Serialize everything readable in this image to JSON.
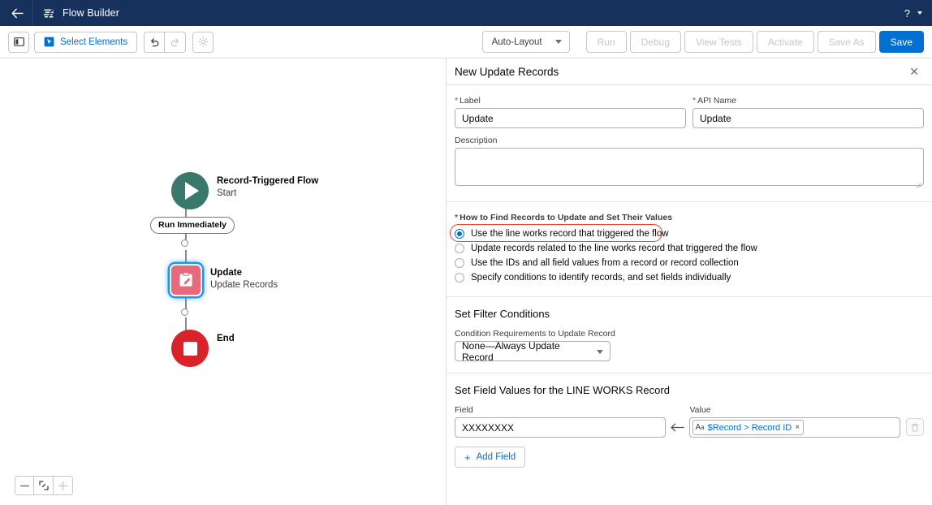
{
  "header": {
    "back_icon": "arrow-left-icon",
    "logo_icon": "flow-builder-logo-icon",
    "title": "Flow Builder",
    "help_icon": "question-mark-icon",
    "help_caret_icon": "chevron-down-icon"
  },
  "toolbar": {
    "panel_toggle_icon": "side-panel-icon",
    "select_elements_icon": "cursor-select-icon",
    "select_elements_label": "Select Elements",
    "undo_icon": "undo-icon",
    "redo_icon": "redo-icon",
    "settings_icon": "gear-icon",
    "layout_mode": "Auto-Layout",
    "layout_caret_icon": "chevron-down-icon",
    "actions": [
      {
        "label": "Run",
        "enabled": false
      },
      {
        "label": "Debug",
        "enabled": false
      },
      {
        "label": "View Tests",
        "enabled": false
      },
      {
        "label": "Activate",
        "enabled": false
      },
      {
        "label": "Save As",
        "enabled": false
      },
      {
        "label": "Save",
        "enabled": true,
        "primary": true
      }
    ],
    "primary_color": "#0070d2"
  },
  "canvas": {
    "start_node": {
      "icon": "play-icon",
      "title": "Record-Triggered Flow",
      "subtitle": "Start",
      "color": "#39796b"
    },
    "run_badge": "Run Immediately",
    "update_node": {
      "icon": "update-records-clipboard-icon",
      "title": "Update",
      "subtitle": "Update Records",
      "color": "#e8697d",
      "selected": true
    },
    "end_node": {
      "icon": "stop-square-icon",
      "title": "End",
      "color": "#d8232a"
    },
    "zoom_controls": [
      {
        "name": "zoom-out-button",
        "icon": "minus-icon",
        "enabled": true
      },
      {
        "name": "zoom-to-fit-button",
        "icon": "fit-to-view-icon",
        "enabled": true
      },
      {
        "name": "zoom-in-button",
        "icon": "plus-icon",
        "enabled": false
      }
    ]
  },
  "panel": {
    "title": "New Update Records",
    "close_icon": "close-icon",
    "label_field": {
      "label": "Label",
      "required": true,
      "value": "Update",
      "placeholder": ""
    },
    "api_name_field": {
      "label": "API Name",
      "required": true,
      "value": "Update",
      "placeholder": ""
    },
    "description_field": {
      "label": "Description",
      "value": "",
      "placeholder": ""
    },
    "how_to_find": {
      "label": "How to Find Records to Update and Set Their Values",
      "required": true,
      "selected_index": 0,
      "options": [
        "Use the line works record that triggered the flow",
        "Update records related to the line works record that triggered the flow",
        "Use the IDs and all field values from a record or record collection",
        "Specify conditions to identify records, and set fields individually"
      ],
      "annotation_color": "#e8452c"
    },
    "filter_section": {
      "title": "Set Filter Conditions",
      "condition_label": "Condition Requirements to Update Record",
      "condition_value": "None—Always Update Record",
      "caret_icon": "chevron-down-icon"
    },
    "field_values_section": {
      "title": "Set Field Values for the LINE WORKS Record",
      "field_label": "Field",
      "field_value": "XXXXXXXX",
      "arrow_icon": "arrow-left-icon",
      "value_label": "Value",
      "value_pill": {
        "type_icon": "text-type-icon",
        "type_icon_main": "A",
        "type_icon_sub": "a",
        "text": "$Record > Record ID",
        "remove_icon": "×"
      },
      "delete_icon": "trash-icon",
      "add_field_icon": "plus-icon",
      "add_field_label": "Add Field"
    }
  }
}
